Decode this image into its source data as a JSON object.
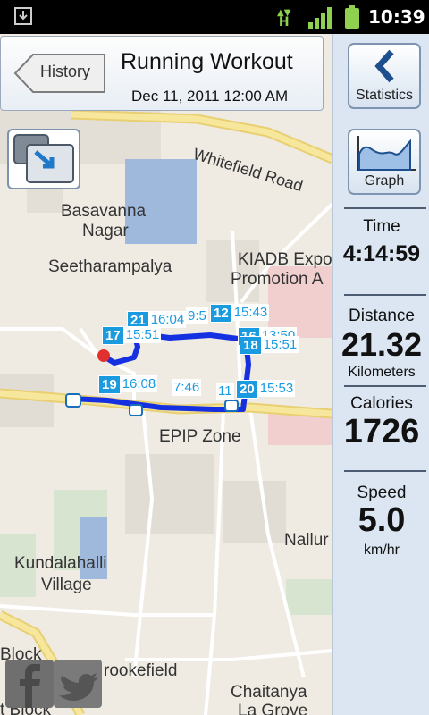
{
  "status_bar": {
    "time": "10:39",
    "network_label": "H"
  },
  "header": {
    "back_label": "History",
    "title": "Running Workout",
    "date": "Dec 11, 2011 12:00 AM"
  },
  "side_panel": {
    "statistics_label": "Statistics",
    "graph_label": "Graph",
    "time_label": "Time",
    "time_value": "4:14:59",
    "distance_label": "Distance",
    "distance_value": "21.32",
    "distance_unit": "Kilometers",
    "calories_label": "Calories",
    "calories_value": "1726",
    "speed_label": "Speed",
    "speed_value": "5.0",
    "speed_unit": "km/hr"
  },
  "map": {
    "labels": {
      "whitefield": "Whitefield Road",
      "basavanna": "Basavanna",
      "nagar": "Nagar",
      "seetharampalya": "Seetharampalya",
      "kiadb": "KIADB Expo",
      "promotion": "Promotion A",
      "epip": "EPIP Zone",
      "nallur": "Nallur",
      "kundalahalli": "Kundalahalli",
      "village": "Village",
      "block1": "Block",
      "block2": "t Block",
      "brookefield": "rookefield",
      "chaitanya": "Chaitanya",
      "lagrove": "La Grove"
    },
    "markers": [
      {
        "num": "21",
        "time": "16:04"
      },
      {
        "num": "17",
        "time": "15:51"
      },
      {
        "num": "12",
        "time": "15:43"
      },
      {
        "num": "",
        "time": "9:5"
      },
      {
        "num": "16",
        "time": "13:50"
      },
      {
        "num": "18",
        "time": "15:51"
      },
      {
        "num": "19",
        "time": "16:08"
      },
      {
        "num": "",
        "time": "7:46"
      },
      {
        "num": "",
        "time": "11"
      },
      {
        "num": "20",
        "time": "15:53"
      }
    ]
  },
  "social": {
    "facebook": "facebook-icon",
    "twitter": "twitter-icon"
  }
}
